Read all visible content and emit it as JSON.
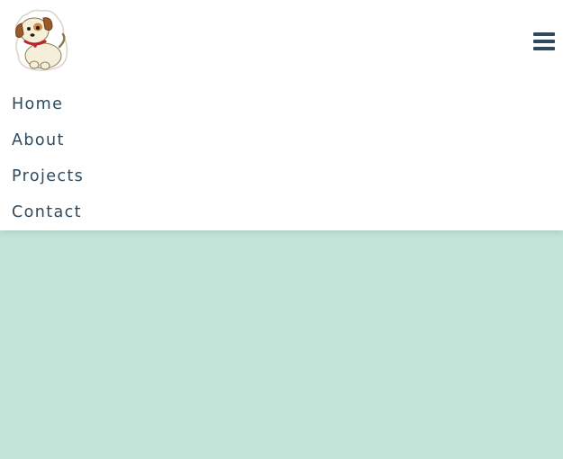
{
  "colors": {
    "nav_text": "#2d4a5e",
    "hamburger": "#2d4a5e",
    "background": "#c1e6d9",
    "header_bg": "#ffffff"
  },
  "header": {
    "logo_icon": "puppy-icon",
    "menu_icon": "hamburger-menu-icon"
  },
  "nav": {
    "items": [
      {
        "label": "Home"
      },
      {
        "label": "About"
      },
      {
        "label": "Projects"
      },
      {
        "label": "Contact"
      }
    ]
  }
}
